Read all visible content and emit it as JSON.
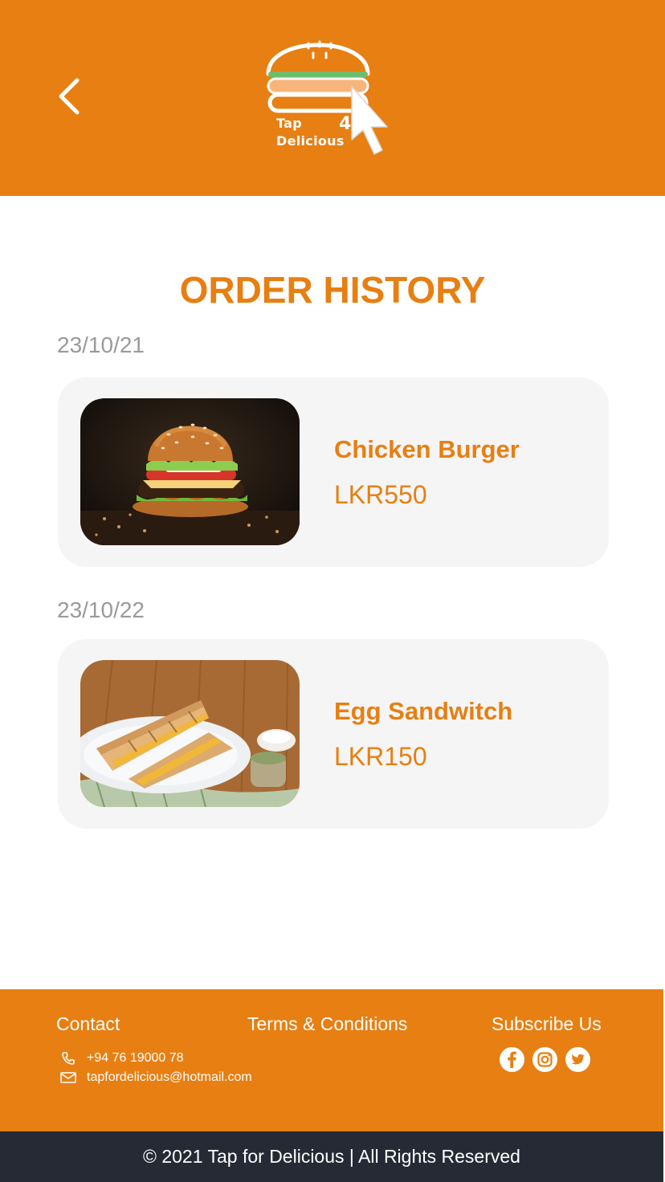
{
  "header": {
    "logo_line1": "Tap",
    "logo_line2": "Delicious",
    "logo_digit": "4"
  },
  "page": {
    "title": "ORDER HISTORY"
  },
  "orders": [
    {
      "date": "23/10/21",
      "name": "Chicken Burger",
      "price": "LKR550"
    },
    {
      "date": "23/10/22",
      "name": "Egg Sandwitch",
      "price": "LKR150"
    }
  ],
  "footer": {
    "contact_heading": "Contact",
    "terms_heading": "Terms & Conditions",
    "subscribe_heading": "Subscribe Us",
    "phone": "+94 76 19000 78",
    "email": "tapfordelicious@hotmail.com",
    "copyright": "© 2021 Tap for Delicious | All Rights Reserved"
  },
  "icons": {
    "back": "chevron-left-icon",
    "phone": "phone-icon",
    "email": "mail-icon",
    "social": [
      "facebook-icon",
      "instagram-icon",
      "twitter-icon"
    ]
  },
  "colors": {
    "brand_orange": "#E77F12",
    "card_bg": "#F5F5F5",
    "date_gray": "#9A9A9A",
    "bottom_bar": "#262A35"
  }
}
